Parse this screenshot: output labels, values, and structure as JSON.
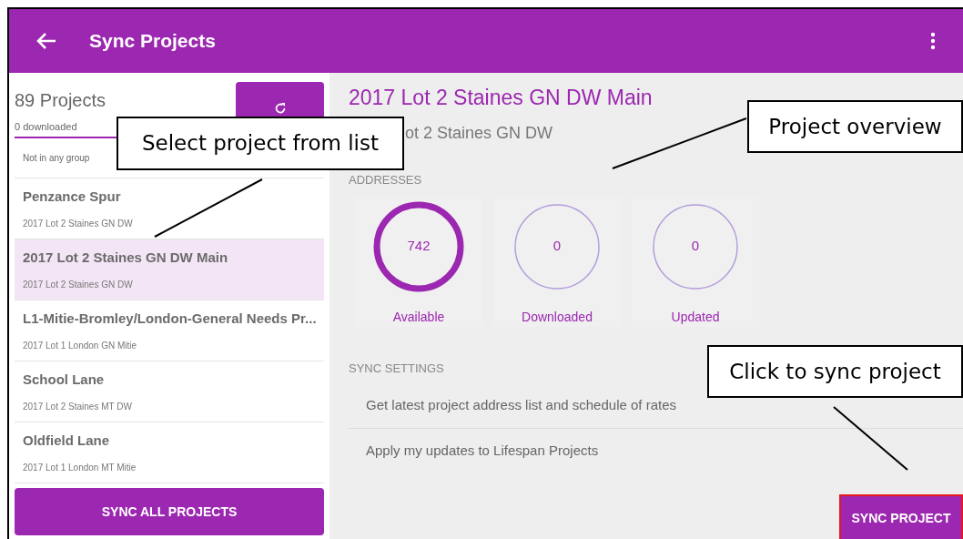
{
  "app_bar": {
    "title": "Sync Projects"
  },
  "sidebar": {
    "count": "89 Projects",
    "downloaded": "0 downloaded",
    "group": "Not in any group",
    "items": [
      {
        "title": "Penzance Spur",
        "subtitle": "2017 Lot 2 Staines GN DW",
        "selected": false
      },
      {
        "title": "2017 Lot 2 Staines GN DW Main",
        "subtitle": "2017 Lot 2 Staines GN DW",
        "selected": true
      },
      {
        "title": "L1-Mitie-Bromley/London-General Needs Pr...",
        "subtitle": "2017 Lot 1 London GN Mitie",
        "selected": false
      },
      {
        "title": "School Lane",
        "subtitle": "2017 Lot 2 Staines MT DW",
        "selected": false
      },
      {
        "title": "Oldfield Lane",
        "subtitle": "2017 Lot 1 London MT Mitie",
        "selected": false
      }
    ],
    "sync_all_button": "SYNC ALL PROJECTS"
  },
  "detail": {
    "title": "2017 Lot 2 Staines GN DW Main",
    "subtitle": "ot 2 Staines GN DW",
    "addresses_heading": "ADDRESSES",
    "stats": [
      {
        "value": "742",
        "label": "Available",
        "kind": "filled"
      },
      {
        "value": "0",
        "label": "Downloaded",
        "kind": "outline"
      },
      {
        "value": "0",
        "label": "Updated",
        "kind": "outline"
      }
    ],
    "sync_settings_heading": "SYNC SETTINGS",
    "settings": [
      "Get latest project address list and schedule of rates",
      "Apply my updates to Lifespan Projects"
    ],
    "sync_button": "SYNC PROJECT"
  },
  "callouts": [
    {
      "text": "Select project from list"
    },
    {
      "text": "Project overview"
    },
    {
      "text": "Click to sync project"
    }
  ]
}
